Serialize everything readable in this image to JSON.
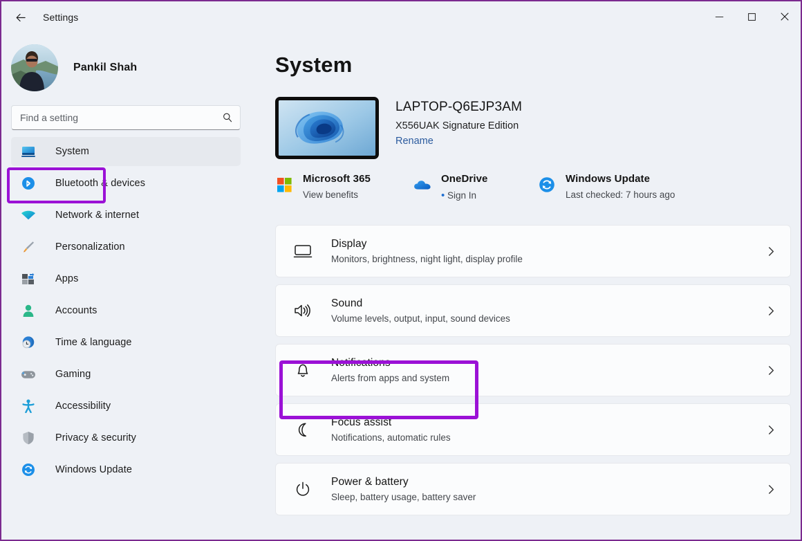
{
  "window": {
    "title": "Settings",
    "back_icon": "back-arrow-icon",
    "minimize_label": "Minimize",
    "maximize_label": "Maximize",
    "close_label": "Close"
  },
  "sidebar": {
    "profile": {
      "name": "Pankil Shah",
      "avatar": "user-avatar"
    },
    "search": {
      "placeholder": "Find a setting",
      "value": "",
      "icon": "search-icon"
    },
    "items": [
      {
        "label": "System",
        "icon": "monitor-icon",
        "selected": true
      },
      {
        "label": "Bluetooth & devices",
        "icon": "bluetooth-icon",
        "selected": false
      },
      {
        "label": "Network & internet",
        "icon": "wifi-icon",
        "selected": false
      },
      {
        "label": "Personalization",
        "icon": "paintbrush-icon",
        "selected": false
      },
      {
        "label": "Apps",
        "icon": "apps-grid-icon",
        "selected": false
      },
      {
        "label": "Accounts",
        "icon": "person-icon",
        "selected": false
      },
      {
        "label": "Time & language",
        "icon": "clock-globe-icon",
        "selected": false
      },
      {
        "label": "Gaming",
        "icon": "gamepad-icon",
        "selected": false
      },
      {
        "label": "Accessibility",
        "icon": "accessibility-icon",
        "selected": false
      },
      {
        "label": "Privacy & security",
        "icon": "shield-icon",
        "selected": false
      },
      {
        "label": "Windows Update",
        "icon": "windows-update-icon",
        "selected": false
      }
    ]
  },
  "main": {
    "page_title": "System",
    "device": {
      "name": "LAPTOP-Q6EJP3AM",
      "model": "X556UAK Signature Edition",
      "rename_label": "Rename",
      "thumbnail": "windows-bloom-wallpaper"
    },
    "quick_links": [
      {
        "title": "Microsoft 365",
        "subtitle": "View benefits",
        "icon": "microsoft-logo-icon",
        "bullet": false
      },
      {
        "title": "OneDrive",
        "subtitle": "Sign In",
        "icon": "onedrive-cloud-icon",
        "bullet": true
      },
      {
        "title": "Windows Update",
        "subtitle": "Last checked: 7 hours ago",
        "icon": "windows-update-icon",
        "bullet": false
      }
    ],
    "cards": [
      {
        "title": "Display",
        "subtitle": "Monitors, brightness, night light, display profile",
        "icon": "monitor-outline-icon",
        "chevron": "chevron-right-icon"
      },
      {
        "title": "Sound",
        "subtitle": "Volume levels, output, input, sound devices",
        "icon": "speaker-icon",
        "chevron": "chevron-right-icon"
      },
      {
        "title": "Notifications",
        "subtitle": "Alerts from apps and system",
        "icon": "bell-icon",
        "chevron": "chevron-right-icon"
      },
      {
        "title": "Focus assist",
        "subtitle": "Notifications, automatic rules",
        "icon": "moon-icon",
        "chevron": "chevron-right-icon"
      },
      {
        "title": "Power & battery",
        "subtitle": "Sleep, battery usage, battery saver",
        "icon": "power-icon",
        "chevron": "chevron-right-icon"
      }
    ]
  },
  "annotations": {
    "highlight_color": "#9b11d6",
    "frame_color": "#7b2a8f",
    "highlighted_sidebar_item": "System",
    "highlighted_card": "Notifications"
  }
}
